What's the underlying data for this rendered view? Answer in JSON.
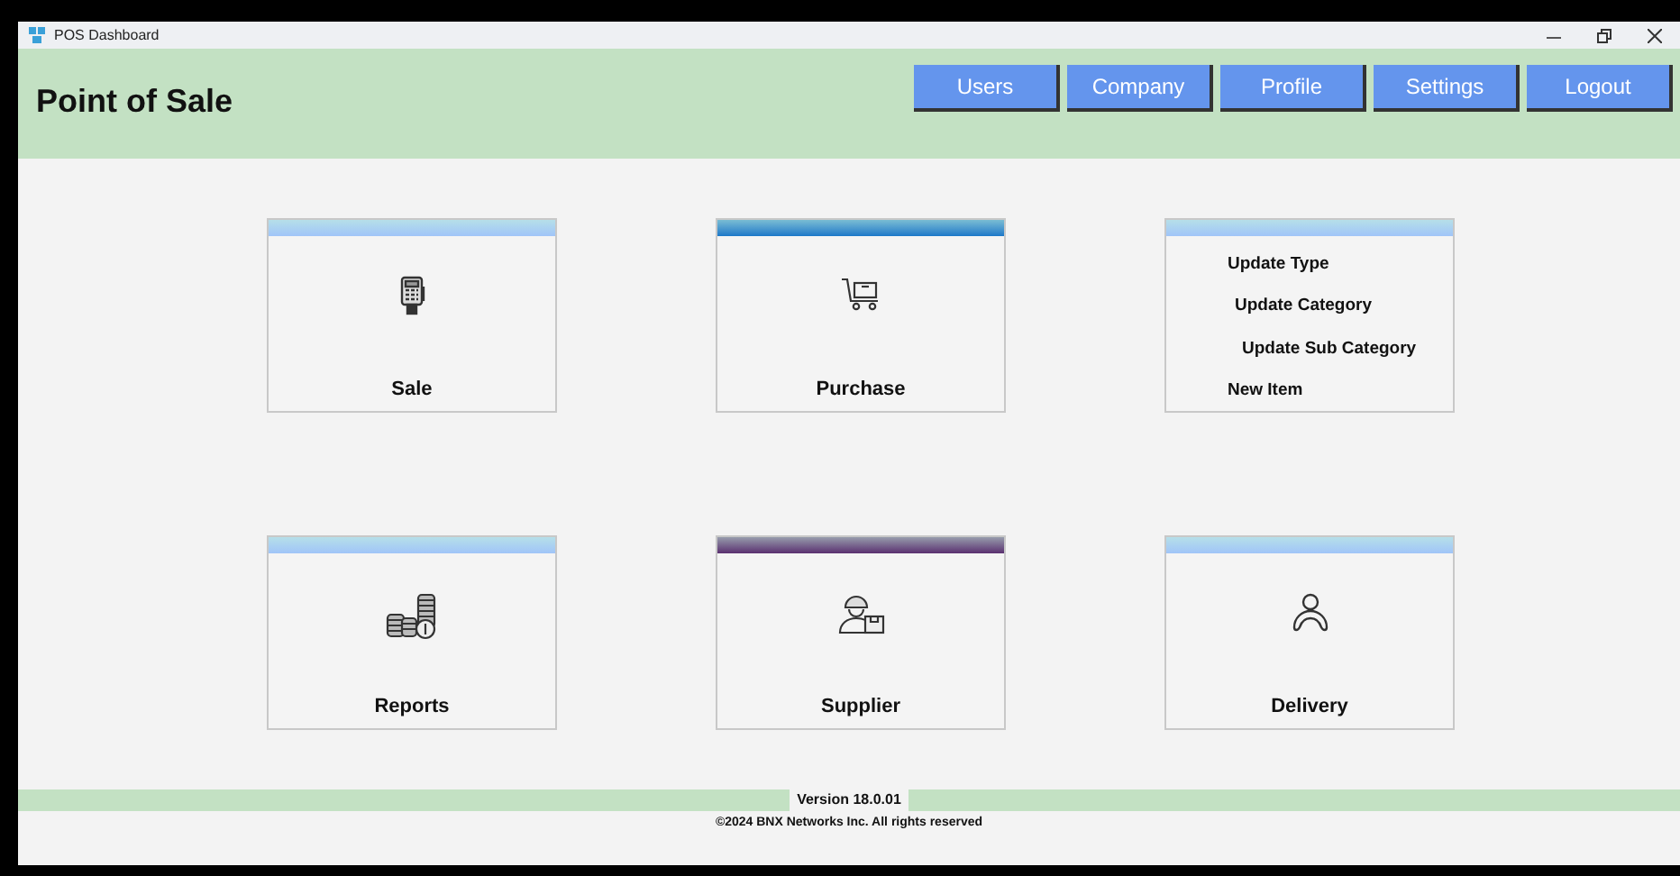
{
  "window": {
    "title": "POS Dashboard"
  },
  "header": {
    "title": "Point of Sale",
    "buttons": [
      "Users",
      "Company",
      "Profile",
      "Settings",
      "Logout"
    ]
  },
  "tiles": [
    {
      "kind": "icon",
      "label": "Sale",
      "color": "#a0c4f8"
    },
    {
      "kind": "icon",
      "label": "Purchase",
      "color": "#1a78c8"
    },
    {
      "kind": "menu",
      "items": [
        "Update Type",
        "Update Category",
        "Update Sub Category",
        "New Item"
      ],
      "color": "#a0c4f8"
    },
    {
      "kind": "icon",
      "label": "Reports",
      "color": "#a0c4f8"
    },
    {
      "kind": "icon",
      "label": "Supplier",
      "color": "#5a3070"
    },
    {
      "kind": "icon",
      "label": "Delivery",
      "color": "#a0c4f8"
    }
  ],
  "footer": {
    "version": "Version 18.0.01",
    "copyright": "©2024 BNX Networks Inc. All rights reserved"
  }
}
